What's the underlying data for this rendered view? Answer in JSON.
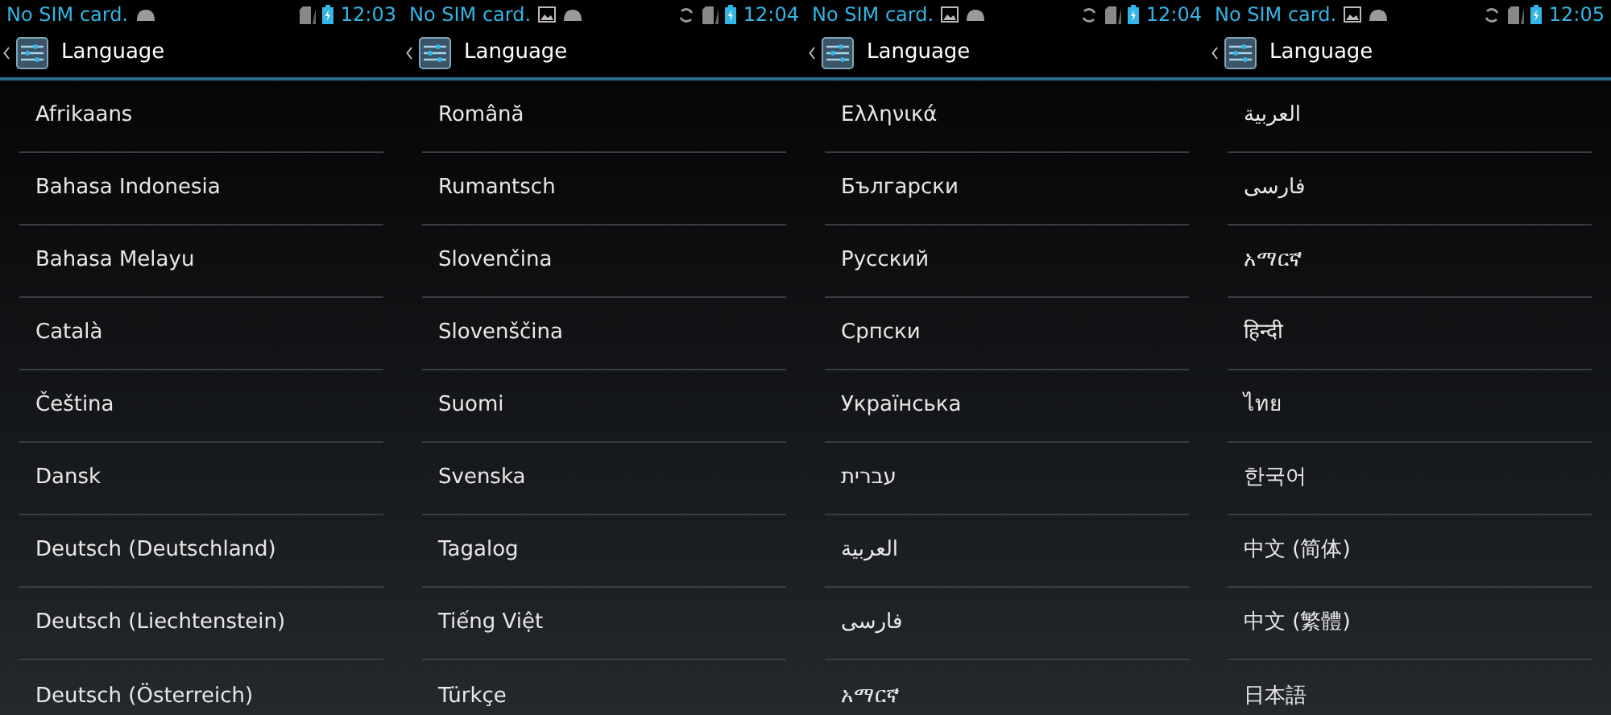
{
  "panels": [
    {
      "status_bar": {
        "carrier": "No SIM card.",
        "picture_notification": false,
        "sync_icon": false,
        "time": "12:03"
      },
      "action_bar": {
        "title": "Language"
      },
      "items": [
        "Afrikaans",
        "Bahasa Indonesia",
        "Bahasa Melayu",
        "Català",
        "Čeština",
        "Dansk",
        "Deutsch (Deutschland)",
        "Deutsch (Liechtenstein)",
        "Deutsch (Österreich)"
      ]
    },
    {
      "status_bar": {
        "carrier": "No SIM card.",
        "picture_notification": true,
        "sync_icon": true,
        "time": "12:04"
      },
      "action_bar": {
        "title": "Language"
      },
      "items": [
        "Română",
        "Rumantsch",
        "Slovenčina",
        "Slovenščina",
        "Suomi",
        "Svenska",
        "Tagalog",
        "Tiếng Việt",
        "Türkçe"
      ]
    },
    {
      "status_bar": {
        "carrier": "No SIM card.",
        "picture_notification": true,
        "sync_icon": true,
        "time": "12:04"
      },
      "action_bar": {
        "title": "Language"
      },
      "items": [
        "Ελληνικά",
        "Български",
        "Русский",
        "Српски",
        "Українська",
        "עברית",
        "العربية",
        "فارسی",
        "አማርኛ"
      ]
    },
    {
      "status_bar": {
        "carrier": "No SIM card.",
        "picture_notification": true,
        "sync_icon": true,
        "time": "12:05"
      },
      "action_bar": {
        "title": "Language"
      },
      "items": [
        "العربية",
        "فارسی",
        "አማርኛ",
        "हिन्दी",
        "ไทย",
        "한국어",
        "中文 (简体)",
        "中文 (繁體)",
        "日本語"
      ]
    }
  ]
}
